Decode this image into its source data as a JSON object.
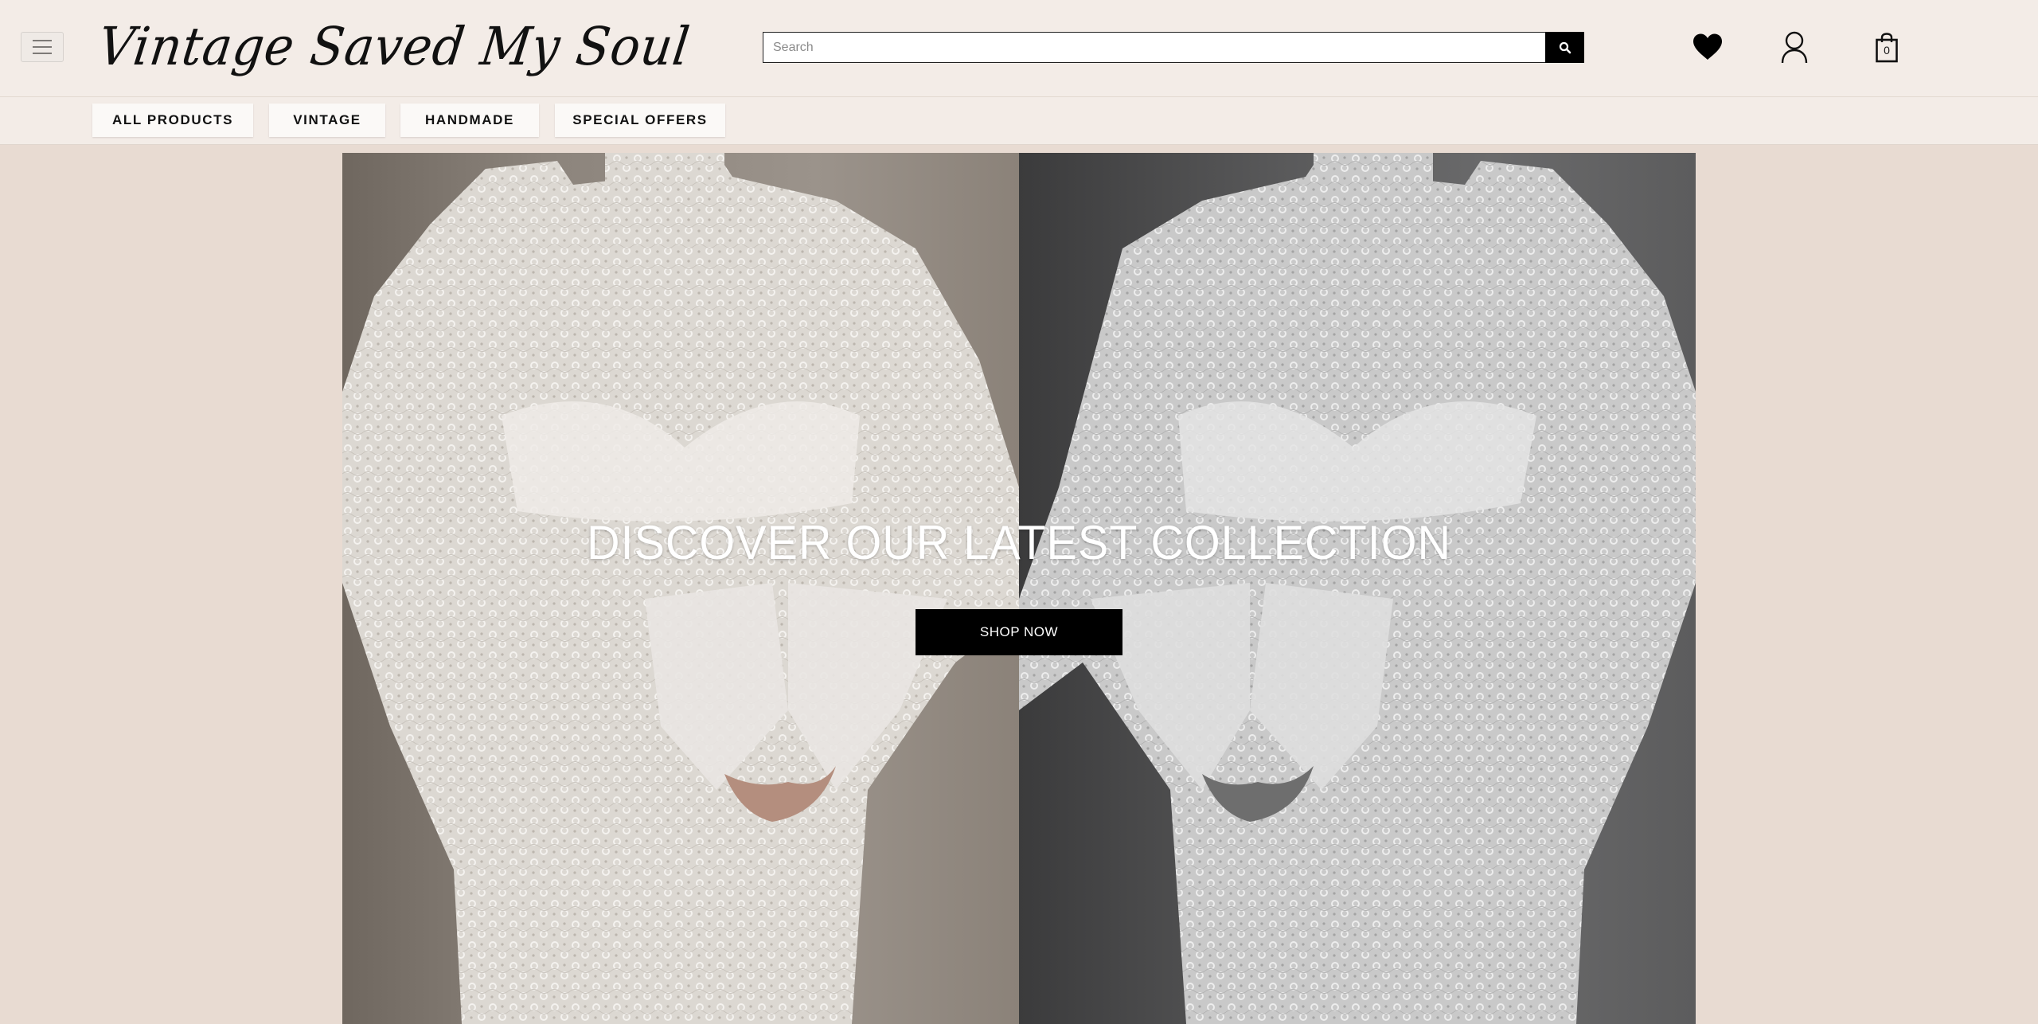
{
  "header": {
    "logo_text": "Vintage Saved My Soul",
    "search": {
      "placeholder": "Search",
      "value": ""
    },
    "icons": {
      "menu": "hamburger-icon",
      "search": "search-icon",
      "wishlist": "heart-icon",
      "account": "user-icon",
      "cart": "shopping-bag-icon"
    },
    "cart_count": "0"
  },
  "nav": {
    "items": [
      {
        "label": "ALL PRODUCTS"
      },
      {
        "label": "VINTAGE"
      },
      {
        "label": "HANDMADE"
      },
      {
        "label": "SPECIAL OFFERS"
      }
    ]
  },
  "hero": {
    "title": "DISCOVER OUR LATEST COLLECTION",
    "cta_label": "SHOP NOW",
    "image_description_left": "white lace dress, colour",
    "image_description_right": "white lace dress, black and white"
  },
  "colors": {
    "page_background": "#e8dbd2",
    "header_background": "#f3ece7",
    "button": "#000000",
    "text": "#111111"
  }
}
